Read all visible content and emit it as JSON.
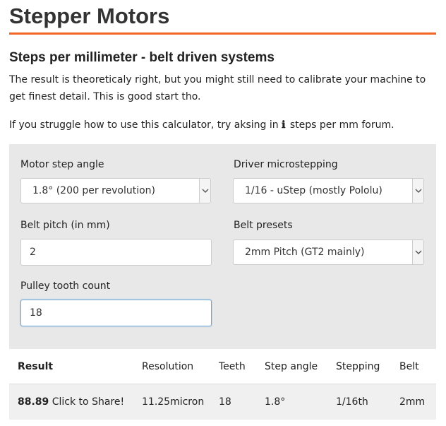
{
  "header": {
    "title": "Stepper Motors",
    "accent_color": "#f26522"
  },
  "section": {
    "title": "Steps per millimeter - belt driven systems",
    "description": "The result is theoreticaly right, but you might still need to calibrate your machine to get finest detail. This is good start tho.",
    "help_prefix": "If you struggle how to use this calculator, try aksing in",
    "help_icon": "info-icon",
    "help_link": "steps per mm forum."
  },
  "form": {
    "motor_step_angle": {
      "label": "Motor step angle",
      "selected": "1.8° (200 per revolution)"
    },
    "driver_microstepping": {
      "label": "Driver microstepping",
      "selected": "1/16 - uStep (mostly Pololu)"
    },
    "belt_pitch": {
      "label": "Belt pitch (in mm)",
      "value": "2"
    },
    "belt_presets": {
      "label": "Belt presets",
      "selected": "2mm Pitch (GT2 mainly)"
    },
    "pulley_tooth_count": {
      "label": "Pulley tooth count",
      "value": "18"
    }
  },
  "results": {
    "columns": [
      "Result",
      "Resolution",
      "Teeth",
      "Step angle",
      "Stepping",
      "Belt"
    ],
    "row": {
      "result_value": "88.89",
      "share_label": "Click to Share!",
      "resolution": "11.25micron",
      "teeth": "18",
      "step_angle": "1.8°",
      "stepping": "1/16th",
      "belt": "2mm"
    }
  }
}
